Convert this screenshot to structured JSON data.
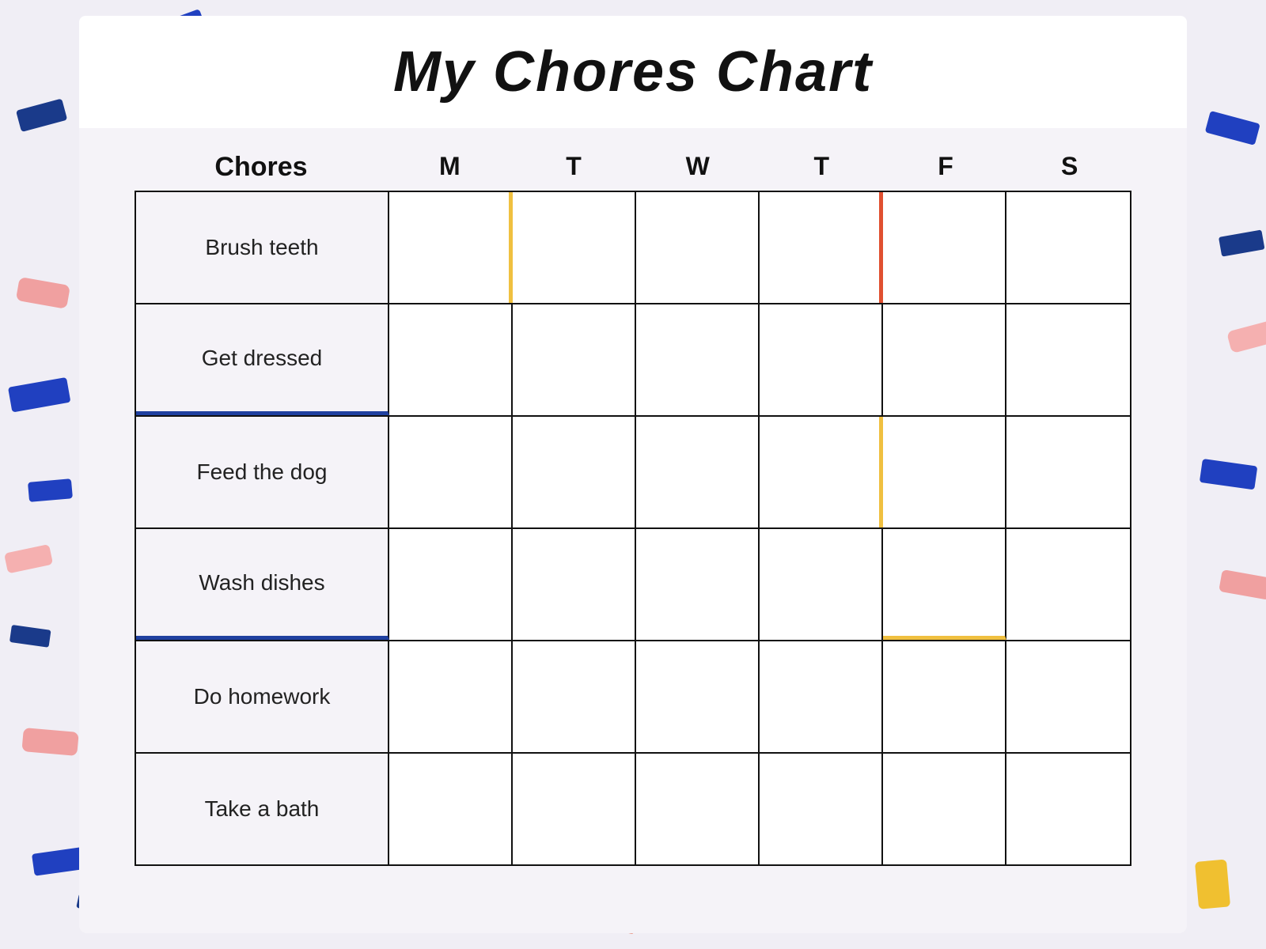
{
  "title": "My Chores Chart",
  "headers": {
    "chores": "Chores",
    "days": [
      "M",
      "T",
      "W",
      "T",
      "F",
      "S"
    ]
  },
  "chores": [
    "Brush teeth",
    "Get dressed",
    "Feed the dog",
    "Wash dishes",
    "Do homework",
    "Take a bath"
  ]
}
